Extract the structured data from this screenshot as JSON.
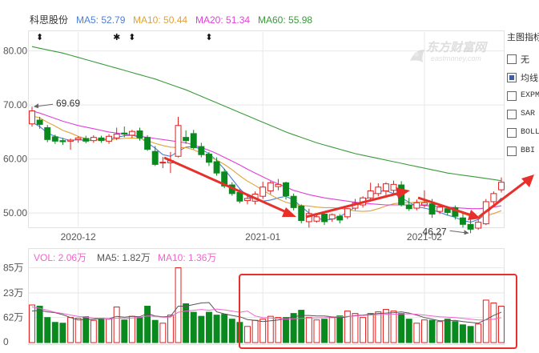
{
  "header": {
    "stock_name": "科思股份",
    "ma5": "MA5: 52.79",
    "ma10": "MA10: 50.44",
    "ma20": "MA20: 51.34",
    "ma60": "MA60: 55.98"
  },
  "volume_header": {
    "vol": "VOL: 2.06万",
    "ma5": "MA5: 1.82万",
    "ma10": "MA10: 1.36万"
  },
  "watermark": {
    "cn": "东方财富网",
    "en": "eastmoney.com"
  },
  "side_panel": {
    "title": "主图指标",
    "options": [
      {
        "label": "无",
        "checked": false,
        "mono": false
      },
      {
        "label": "均线",
        "checked": true,
        "mono": false
      },
      {
        "label": "EXPMA",
        "checked": false,
        "mono": true
      },
      {
        "label": "SAR",
        "checked": false,
        "mono": true
      },
      {
        "label": "BOLL",
        "checked": false,
        "mono": true
      },
      {
        "label": "BBI",
        "checked": false,
        "mono": true
      }
    ]
  },
  "colors": {
    "up": "#e0201e",
    "down": "#0a8a1e",
    "ma5": "#4a7fd8",
    "ma10": "#e0a23a",
    "ma20": "#e040d8",
    "ma60": "#3a9a3a",
    "arrow": "#e8302a",
    "vol_ma5": "#555555",
    "vol_ma10": "#ee66cc",
    "grid": "#e8e8e8",
    "axis_text": "#555555"
  },
  "chart_data": [
    {
      "type": "candlestick",
      "title": "",
      "y_ticks": [
        50,
        60,
        70,
        80
      ],
      "y_tick_labels": [
        "50.00",
        "60.00",
        "70.00",
        "80.00"
      ],
      "ylim": [
        47.5,
        83.5
      ],
      "x_tick_labels": [
        {
          "label": "2020-12",
          "index": 6
        },
        {
          "label": "2021-01",
          "index": 30
        },
        {
          "label": "2021-02",
          "index": 51
        }
      ],
      "annotations": [
        {
          "text": "69.69",
          "index": 0,
          "value": 69.69,
          "kind": "high"
        },
        {
          "text": "46.27",
          "index": 57,
          "value": 46.27,
          "kind": "low"
        }
      ],
      "markers": [
        {
          "symbol": "⬍",
          "index": 1
        },
        {
          "symbol": "✱",
          "index": 11
        },
        {
          "symbol": "⬍",
          "index": 13
        },
        {
          "symbol": "⬍",
          "index": 23
        }
      ],
      "series": [
        {
          "name": "MA5",
          "values": [
            66.8,
            66.0,
            64.8,
            64.2,
            63.8,
            63.4,
            63.6,
            63.4,
            63.5,
            63.7,
            63.6,
            64.0,
            64.3,
            64.4,
            64.0,
            63.0,
            62.0,
            60.8,
            60.5,
            61.4,
            62.2,
            62.3,
            61.8,
            61.0,
            59.7,
            58.1,
            56.3,
            54.5,
            53.1,
            52.4,
            52.2,
            52.4,
            52.8,
            53.1,
            52.4,
            51.2,
            50.0,
            49.2,
            48.6,
            48.9,
            49.4,
            50.1,
            51.1,
            52.1,
            53.2,
            54.0,
            54.1,
            53.6,
            52.8,
            52.0,
            51.2,
            50.9,
            50.6,
            50.1,
            49.6,
            49.2,
            48.6,
            48.3,
            48.8,
            49.8,
            51.3,
            52.79
          ]
        },
        {
          "name": "MA10",
          "values": [
            68.0,
            67.6,
            66.8,
            66.1,
            65.3,
            64.8,
            64.2,
            63.8,
            63.6,
            63.5,
            63.5,
            63.7,
            63.8,
            63.9,
            63.8,
            63.4,
            62.9,
            62.5,
            62.2,
            62.1,
            62.1,
            61.7,
            61.1,
            60.4,
            59.8,
            59.0,
            58.0,
            56.9,
            55.9,
            55.1,
            54.2,
            53.4,
            52.6,
            52.0,
            51.6,
            51.4,
            51.3,
            51.1,
            51.0,
            51.0,
            50.9,
            50.6,
            50.4,
            50.3,
            50.4,
            50.8,
            51.3,
            51.7,
            51.9,
            51.9,
            52.0,
            52.1,
            52.0,
            51.6,
            51.1,
            50.5,
            49.9,
            49.4,
            49.3,
            49.5,
            49.9,
            50.44
          ]
        },
        {
          "name": "MA20",
          "values": [
            68.9,
            68.5,
            68.0,
            67.5,
            67.0,
            66.6,
            66.2,
            65.9,
            65.6,
            65.3,
            65.0,
            64.8,
            64.6,
            64.4,
            64.2,
            64.0,
            63.8,
            63.6,
            63.4,
            63.2,
            63.0,
            62.6,
            62.1,
            61.6,
            61.0,
            60.3,
            59.6,
            58.9,
            58.1,
            57.4,
            56.7,
            56.0,
            55.4,
            54.8,
            54.2,
            53.8,
            53.4,
            53.1,
            52.8,
            52.6,
            52.4,
            52.2,
            52.0,
            51.8,
            51.7,
            51.6,
            51.5,
            51.5,
            51.5,
            51.5,
            51.5,
            51.4,
            51.3,
            51.2,
            51.1,
            51.0,
            50.9,
            50.8,
            50.8,
            50.9,
            51.1,
            51.34
          ]
        },
        {
          "name": "MA60",
          "values": [
            80.8,
            80.5,
            80.2,
            79.9,
            79.6,
            79.2,
            78.8,
            78.4,
            78.0,
            77.6,
            77.2,
            76.8,
            76.4,
            76.0,
            75.6,
            75.2,
            74.8,
            74.3,
            73.8,
            73.3,
            72.8,
            72.2,
            71.6,
            71.0,
            70.4,
            69.8,
            69.2,
            68.6,
            68.0,
            67.4,
            66.8,
            66.2,
            65.6,
            65.0,
            64.5,
            64.0,
            63.5,
            63.0,
            62.6,
            62.2,
            61.8,
            61.4,
            61.0,
            60.7,
            60.4,
            60.1,
            59.8,
            59.5,
            59.2,
            58.9,
            58.6,
            58.3,
            58.0,
            57.7,
            57.4,
            57.2,
            57.0,
            56.8,
            56.6,
            56.4,
            56.2,
            55.98
          ]
        }
      ],
      "candles": [
        {
          "o": 66.5,
          "h": 69.69,
          "c": 68.9,
          "l": 66.0
        },
        {
          "o": 67.2,
          "h": 67.8,
          "c": 66.4,
          "l": 65.6
        },
        {
          "o": 65.8,
          "h": 66.3,
          "c": 63.6,
          "l": 63.1
        },
        {
          "o": 64.1,
          "h": 64.5,
          "c": 63.3,
          "l": 62.8
        },
        {
          "o": 63.4,
          "h": 63.9,
          "c": 63.2,
          "l": 62.6
        },
        {
          "o": 63.3,
          "h": 63.8,
          "c": 63.5,
          "l": 61.7
        },
        {
          "o": 63.6,
          "h": 64.2,
          "c": 63.9,
          "l": 63.0
        },
        {
          "o": 63.8,
          "h": 64.3,
          "c": 63.3,
          "l": 62.9
        },
        {
          "o": 63.4,
          "h": 64.4,
          "c": 64.0,
          "l": 63.0
        },
        {
          "o": 63.9,
          "h": 64.3,
          "c": 63.4,
          "l": 63.0
        },
        {
          "o": 63.3,
          "h": 64.6,
          "c": 64.2,
          "l": 62.8
        },
        {
          "o": 63.9,
          "h": 65.8,
          "c": 64.6,
          "l": 63.5
        },
        {
          "o": 64.8,
          "h": 66.0,
          "c": 64.6,
          "l": 64.0
        },
        {
          "o": 64.4,
          "h": 65.4,
          "c": 65.1,
          "l": 63.9
        },
        {
          "o": 65.2,
          "h": 65.8,
          "c": 63.9,
          "l": 63.4
        },
        {
          "o": 64.0,
          "h": 64.4,
          "c": 61.8,
          "l": 61.5
        },
        {
          "o": 61.4,
          "h": 62.4,
          "c": 59.0,
          "l": 58.7
        },
        {
          "o": 59.3,
          "h": 60.4,
          "c": 59.4,
          "l": 58.3
        },
        {
          "o": 59.3,
          "h": 61.3,
          "c": 59.7,
          "l": 57.4
        },
        {
          "o": 60.5,
          "h": 67.8,
          "c": 66.2,
          "l": 60.3
        },
        {
          "o": 64.0,
          "h": 65.3,
          "c": 63.4,
          "l": 62.8
        },
        {
          "o": 64.7,
          "h": 65.4,
          "c": 62.1,
          "l": 61.8
        },
        {
          "o": 62.3,
          "h": 63.0,
          "c": 60.8,
          "l": 60.3
        },
        {
          "o": 60.9,
          "h": 61.3,
          "c": 59.4,
          "l": 58.7
        },
        {
          "o": 59.5,
          "h": 60.3,
          "c": 57.4,
          "l": 56.9
        },
        {
          "o": 57.6,
          "h": 58.2,
          "c": 55.0,
          "l": 54.6
        },
        {
          "o": 55.2,
          "h": 55.7,
          "c": 53.6,
          "l": 53.2
        },
        {
          "o": 53.8,
          "h": 54.4,
          "c": 52.2,
          "l": 51.8
        },
        {
          "o": 52.3,
          "h": 53.4,
          "c": 52.7,
          "l": 51.6
        },
        {
          "o": 52.2,
          "h": 54.0,
          "c": 53.5,
          "l": 51.6
        },
        {
          "o": 53.1,
          "h": 55.8,
          "c": 54.8,
          "l": 52.6
        },
        {
          "o": 54.1,
          "h": 55.9,
          "c": 55.6,
          "l": 53.5
        },
        {
          "o": 54.9,
          "h": 56.3,
          "c": 55.3,
          "l": 54.2
        },
        {
          "o": 55.6,
          "h": 55.8,
          "c": 53.2,
          "l": 52.5
        },
        {
          "o": 53.1,
          "h": 53.6,
          "c": 51.0,
          "l": 50.5
        },
        {
          "o": 51.3,
          "h": 51.6,
          "c": 48.6,
          "l": 48.1
        },
        {
          "o": 48.4,
          "h": 50.8,
          "c": 49.9,
          "l": 47.3
        },
        {
          "o": 48.5,
          "h": 49.6,
          "c": 49.3,
          "l": 48.2
        },
        {
          "o": 49.8,
          "h": 50.0,
          "c": 48.4,
          "l": 47.8
        },
        {
          "o": 48.9,
          "h": 49.9,
          "c": 49.7,
          "l": 48.4
        },
        {
          "o": 49.4,
          "h": 49.8,
          "c": 48.7,
          "l": 48.1
        },
        {
          "o": 49.3,
          "h": 50.9,
          "c": 50.8,
          "l": 48.9
        },
        {
          "o": 50.9,
          "h": 52.6,
          "c": 51.9,
          "l": 50.5
        },
        {
          "o": 51.5,
          "h": 53.1,
          "c": 52.8,
          "l": 51.0
        },
        {
          "o": 52.8,
          "h": 55.6,
          "c": 54.1,
          "l": 52.5
        },
        {
          "o": 53.6,
          "h": 55.5,
          "c": 54.8,
          "l": 53.1
        },
        {
          "o": 54.1,
          "h": 55.7,
          "c": 55.4,
          "l": 53.3
        },
        {
          "o": 54.2,
          "h": 56.0,
          "c": 55.3,
          "l": 53.7
        },
        {
          "o": 55.2,
          "h": 55.9,
          "c": 51.5,
          "l": 51.2
        },
        {
          "o": 51.5,
          "h": 52.8,
          "c": 50.8,
          "l": 50.4
        },
        {
          "o": 50.9,
          "h": 52.5,
          "c": 51.9,
          "l": 50.5
        },
        {
          "o": 51.5,
          "h": 54.2,
          "c": 51.9,
          "l": 51.0
        },
        {
          "o": 51.7,
          "h": 52.6,
          "c": 49.8,
          "l": 49.1
        },
        {
          "o": 50.3,
          "h": 51.6,
          "c": 51.1,
          "l": 49.8
        },
        {
          "o": 50.8,
          "h": 51.3,
          "c": 50.1,
          "l": 49.6
        },
        {
          "o": 51.0,
          "h": 51.4,
          "c": 49.4,
          "l": 48.8
        },
        {
          "o": 49.1,
          "h": 49.9,
          "c": 47.9,
          "l": 47.3
        },
        {
          "o": 47.9,
          "h": 49.2,
          "c": 47.0,
          "l": 46.27
        },
        {
          "o": 47.2,
          "h": 48.8,
          "c": 48.3,
          "l": 46.9
        },
        {
          "o": 48.0,
          "h": 52.6,
          "c": 52.1,
          "l": 47.8
        },
        {
          "o": 52.1,
          "h": 54.0,
          "c": 53.6,
          "l": 51.4
        },
        {
          "o": 54.3,
          "h": 56.6,
          "c": 55.7,
          "l": 53.8
        }
      ]
    },
    {
      "type": "bar",
      "title": "",
      "y_tick_labels": [
        "0",
        "62万",
        "23万",
        "85万"
      ],
      "y_tick_values": [
        0,
        0.62,
        1.23,
        1.85
      ],
      "ylim": [
        0,
        1.9
      ],
      "volumes": [
        0.93,
        0.9,
        0.62,
        0.5,
        0.48,
        0.62,
        0.6,
        0.64,
        0.55,
        0.6,
        0.58,
        0.88,
        0.56,
        0.65,
        0.62,
        0.9,
        0.55,
        0.48,
        0.68,
        1.85,
        0.96,
        0.75,
        0.65,
        0.75,
        0.68,
        0.7,
        0.58,
        0.5,
        0.4,
        0.55,
        0.58,
        0.65,
        0.62,
        0.62,
        0.72,
        0.8,
        0.62,
        0.56,
        0.58,
        0.62,
        0.66,
        0.78,
        0.72,
        0.62,
        0.72,
        0.76,
        0.82,
        0.78,
        0.72,
        0.58,
        0.48,
        0.56,
        0.55,
        0.52,
        0.58,
        0.52,
        0.44,
        0.4,
        0.46,
        1.05,
        0.98,
        0.9
      ],
      "series": [
        {
          "name": "MA5",
          "values": [
            0.78,
            0.8,
            0.76,
            0.74,
            0.69,
            0.62,
            0.56,
            0.57,
            0.58,
            0.6,
            0.59,
            0.65,
            0.63,
            0.65,
            0.64,
            0.72,
            0.66,
            0.64,
            0.65,
            0.9,
            0.9,
            0.94,
            0.98,
            0.99,
            0.76,
            0.71,
            0.67,
            0.64,
            0.57,
            0.55,
            0.52,
            0.54,
            0.56,
            0.6,
            0.64,
            0.67,
            0.67,
            0.66,
            0.66,
            0.64,
            0.61,
            0.64,
            0.67,
            0.68,
            0.7,
            0.72,
            0.73,
            0.74,
            0.76,
            0.73,
            0.68,
            0.62,
            0.58,
            0.54,
            0.54,
            0.55,
            0.52,
            0.5,
            0.48,
            0.57,
            0.67,
            0.75
          ]
        },
        {
          "name": "MA10",
          "values": [
            0.88,
            0.85,
            0.8,
            0.75,
            0.72,
            0.68,
            0.65,
            0.63,
            0.61,
            0.6,
            0.58,
            0.61,
            0.6,
            0.61,
            0.62,
            0.66,
            0.65,
            0.63,
            0.63,
            0.75,
            0.78,
            0.8,
            0.82,
            0.8,
            0.83,
            0.81,
            0.78,
            0.75,
            0.78,
            0.66,
            0.62,
            0.61,
            0.6,
            0.58,
            0.59,
            0.6,
            0.61,
            0.61,
            0.62,
            0.64,
            0.64,
            0.65,
            0.66,
            0.67,
            0.68,
            0.69,
            0.7,
            0.7,
            0.71,
            0.71,
            0.7,
            0.68,
            0.66,
            0.64,
            0.63,
            0.62,
            0.6,
            0.58,
            0.56,
            0.56,
            0.58,
            0.62
          ]
        }
      ]
    }
  ]
}
